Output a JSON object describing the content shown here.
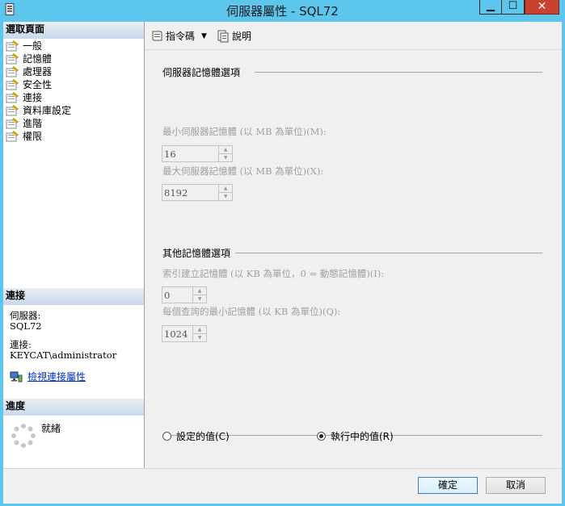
{
  "window": {
    "title": "伺服器屬性 - SQL72"
  },
  "left_panel": {
    "select_page_header": "選取頁面",
    "pages": [
      {
        "label": "一般"
      },
      {
        "label": "記憶體"
      },
      {
        "label": "處理器"
      },
      {
        "label": "安全性"
      },
      {
        "label": "連接"
      },
      {
        "label": "資料庫設定"
      },
      {
        "label": "進階"
      },
      {
        "label": "權限"
      }
    ],
    "connection_header": "連接",
    "server_label": "伺服器:",
    "server_value": "SQL72",
    "connection_label": "連接:",
    "connection_value": "KEYCAT\\administrator",
    "view_connection_link": "檢視連接屬性",
    "progress_header": "進度",
    "progress_status": "就緒"
  },
  "toolbar": {
    "script_label": "指令碼",
    "help_label": "說明"
  },
  "memory": {
    "server_memory_group": "伺服器記憶體選項",
    "min_memory_label": "最小伺服器記憶體 (以 MB 為單位)(M):",
    "min_memory_value": "16",
    "max_memory_label": "最大伺服器記憶體 (以 MB 為單位)(X):",
    "max_memory_value": "8192",
    "other_memory_group": "其他記憶體選項",
    "index_memory_label": "索引建立記憶體 (以 KB 為單位，0 = 動態記憶體)(I):",
    "index_memory_value": "0",
    "min_query_memory_label": "每個查詢的最小記憶體 (以 KB 為單位)(Q):",
    "min_query_memory_value": "1024",
    "configured_values_label": "設定的值(C)",
    "running_values_label": "執行中的值(R)",
    "selected_option": "running"
  },
  "buttons": {
    "ok": "確定",
    "cancel": "取消"
  },
  "colors": {
    "title_bar": "#5cc6ec",
    "close_button": "#c7422f",
    "link": "#0033cc",
    "disabled_text": "#a0a0a0"
  }
}
